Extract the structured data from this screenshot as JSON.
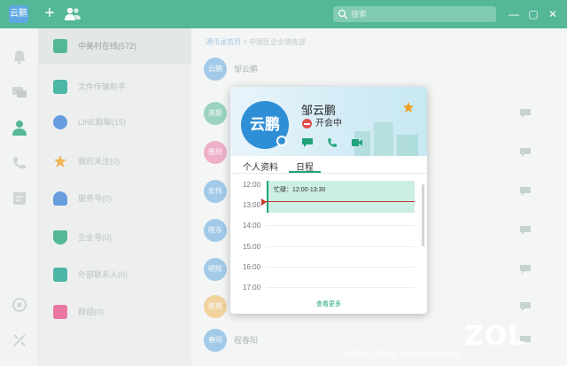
{
  "titlebar": {
    "app_avatar_text": "云鹏",
    "search_placeholder": "搜索",
    "plus": "+",
    "minimize": "—",
    "maximize": "▢",
    "close": "✕"
  },
  "groups": [
    {
      "label": "中美村在线(572)",
      "color": "#1fa37a",
      "icon": "org-icon"
    },
    {
      "label": "文件传输助手",
      "color": "#16a38a",
      "icon": "folder-icon"
    },
    {
      "label": "LINE群聊(15)",
      "color": "#3a80d9",
      "icon": "group-chat-icon"
    },
    {
      "label": "我的关注(0)",
      "color": "#f0a020",
      "icon": "star-icon"
    },
    {
      "label": "服务号(0)",
      "color": "#3a80d9",
      "icon": "service-icon"
    },
    {
      "label": "企业号(0)",
      "color": "#1fa37a",
      "icon": "enterprise-icon"
    },
    {
      "label": "外部联系人(0)",
      "color": "#16a38a",
      "icon": "external-contact-icon"
    },
    {
      "label": "群组(0)",
      "color": "#e84c8a",
      "icon": "group-icon"
    }
  ],
  "main": {
    "breadcrumb_link": "通讯录首页",
    "breadcrumb_rest": " > 中国区企业销售部",
    "rows": [
      {
        "avatar": "云鹏",
        "name": "邹云鹏",
        "color": "#2f8fd6"
      },
      {
        "avatar": "英姬",
        "name": "",
        "color": "#1fa37a"
      },
      {
        "avatar": "雅欣",
        "name": "",
        "color": "#e84c8a"
      },
      {
        "avatar": "宏伟",
        "name": "",
        "color": "#2f8fd6"
      },
      {
        "avatar": "晓东",
        "name": "",
        "color": "#2f8fd6"
      },
      {
        "avatar": "明辉",
        "name": "",
        "color": "#2f8fd6"
      },
      {
        "avatar": "雅楠",
        "name": "",
        "color": "#f0a020"
      },
      {
        "avatar": "春阳",
        "name": "程春阳",
        "color": "#2f8fd6"
      }
    ]
  },
  "card": {
    "avatar_text": "云鹏",
    "name": "邹云鹏",
    "status": "开会中",
    "tabs": [
      "个人资料",
      "日程"
    ],
    "active_tab": "日程",
    "hours": [
      "12:00",
      "13:00",
      "14:00",
      "15:00",
      "16:00",
      "17:00"
    ],
    "event": "忙碌：12:00-13:30",
    "more_link": "查看更多"
  },
  "watermark": {
    "brand": "ZOL",
    "url": "https://blog.csdn.net/cxx"
  }
}
